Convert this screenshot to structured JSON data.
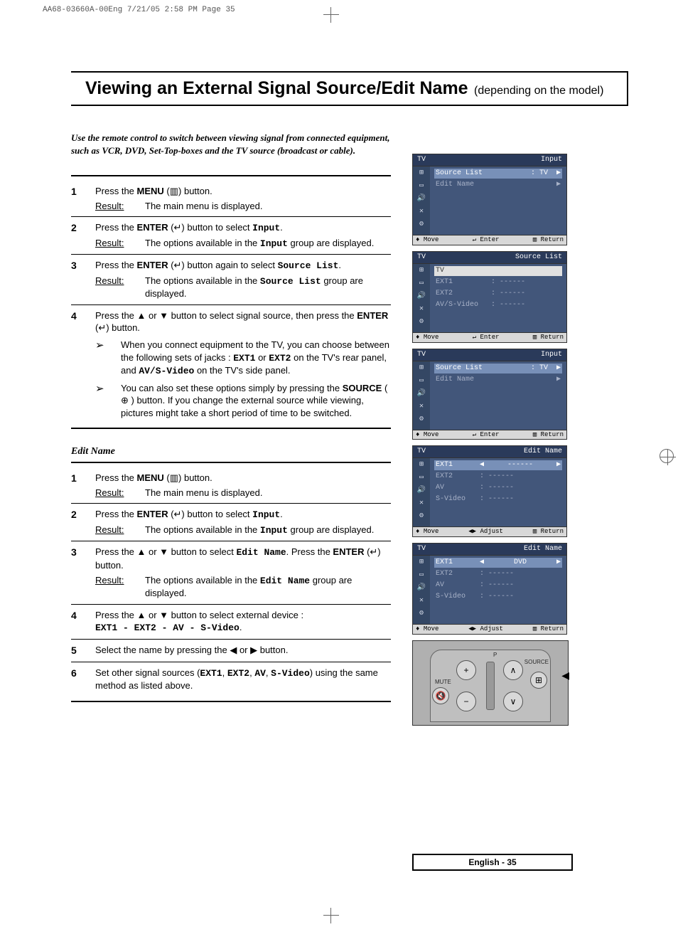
{
  "header_info": "AA68-03660A-00Eng  7/21/05  2:58 PM  Page 35",
  "title_main": "Viewing an External Signal Source/Edit Name",
  "title_sub": "(depending on the model)",
  "intro": "Use the remote control to switch between viewing signal from connected equipment, such as VCR, DVD, Set-Top-boxes and the TV source (broadcast or cable).",
  "result_label": "Result:",
  "stepsA": [
    {
      "n": "1",
      "line1_pre": "Press the ",
      "line1_bold": "MENU",
      "line1_post": " (▥) button.",
      "result": "The main menu is displayed."
    },
    {
      "n": "2",
      "line1_pre": "Press the ",
      "line1_bold": "ENTER",
      "line1_post": " (↵) button to select ",
      "line1_mono": "Input",
      "line1_tail": ".",
      "result_pre": "The options available in the ",
      "result_mono": "Input",
      "result_post": " group are displayed."
    },
    {
      "n": "3",
      "line1_pre": "Press the ",
      "line1_bold": "ENTER",
      "line1_post": " (↵) button again to select ",
      "line1_mono": "Source List",
      "line1_tail": ".",
      "result_pre": "The options available in the ",
      "result_mono": "Source List",
      "result_post": " group are displayed."
    },
    {
      "n": "4",
      "line1": "Press the ▲ or ▼ button to select signal source, then press the ",
      "line1_bold": "ENTER",
      "line1_post": " (↵) button.",
      "note1_pre": "When you connect equipment to the TV, you can choose between the following sets of jacks : ",
      "note1_m1": "EXT1",
      "note1_mid": " or ",
      "note1_m2": "EXT2",
      "note1_mid2": " on the TV's rear panel, and ",
      "note1_m3": "AV/S-Video",
      "note1_post": " on the TV's side panel.",
      "note2_pre": "You can also set these options simply by pressing the ",
      "note2_bold": "SOURCE",
      "note2_post": " ( ⊕ ) button. If you change the external source while viewing, pictures might take a short period of time to be switched."
    }
  ],
  "edit_name_label": "Edit Name",
  "stepsB": [
    {
      "n": "1",
      "line1_pre": "Press the ",
      "line1_bold": "MENU",
      "line1_post": " (▥) button.",
      "result": "The main menu is displayed."
    },
    {
      "n": "2",
      "line1_pre": "Press the ",
      "line1_bold": "ENTER",
      "line1_post": " (↵) button to select ",
      "line1_mono": "Input",
      "line1_tail": ".",
      "result_pre": "The options available in the ",
      "result_mono": "Input",
      "result_post": " group are displayed."
    },
    {
      "n": "3",
      "line1": "Press the ▲ or ▼ button to select ",
      "line1_mono": "Edit Name",
      "line1_post": ". Press the ",
      "line1_bold": "ENTER",
      "line1_tail": " (↵) button.",
      "result_pre": "The options available in the ",
      "result_mono": "Edit Name",
      "result_post": " group are displayed."
    },
    {
      "n": "4",
      "line1": "Press the ▲ or ▼ button to select external device : ",
      "line1_mono": "EXT1 - EXT2 - AV - S-Video",
      "line1_tail": "."
    },
    {
      "n": "5",
      "line1": "Select the name by pressing the ◀ or ▶ button."
    },
    {
      "n": "6",
      "line1_pre": "Set other signal sources (",
      "line1_mono": "EXT1",
      "line1_mid1": ", ",
      "line1_m2": "EXT2",
      "line1_mid2": ", ",
      "line1_m3": "AV",
      "line1_mid3": ", ",
      "line1_m4": "S-Video",
      "line1_post": ") using the same method as listed above."
    }
  ],
  "osd": {
    "tv": "TV",
    "input": "Input",
    "source_list": "Source List",
    "edit_name": "Edit Name",
    "colon_tv": ": TV",
    "arrow_r": "▶",
    "move": "Move",
    "enter": "Enter",
    "return": "Return",
    "adjust": "Adjust",
    "ext1": "EXT1",
    "ext2": "EXT2",
    "av": "AV",
    "svideo": "S-Video",
    "avsvideo": "AV/S-Video",
    "dashes": ": ------",
    "dashes_plain": "------",
    "dvd": "DVD",
    "arrow_l": "◀"
  },
  "remote": {
    "mute": "MUTE",
    "p": "P",
    "source": "SOURCE"
  },
  "footer": "English - 35"
}
